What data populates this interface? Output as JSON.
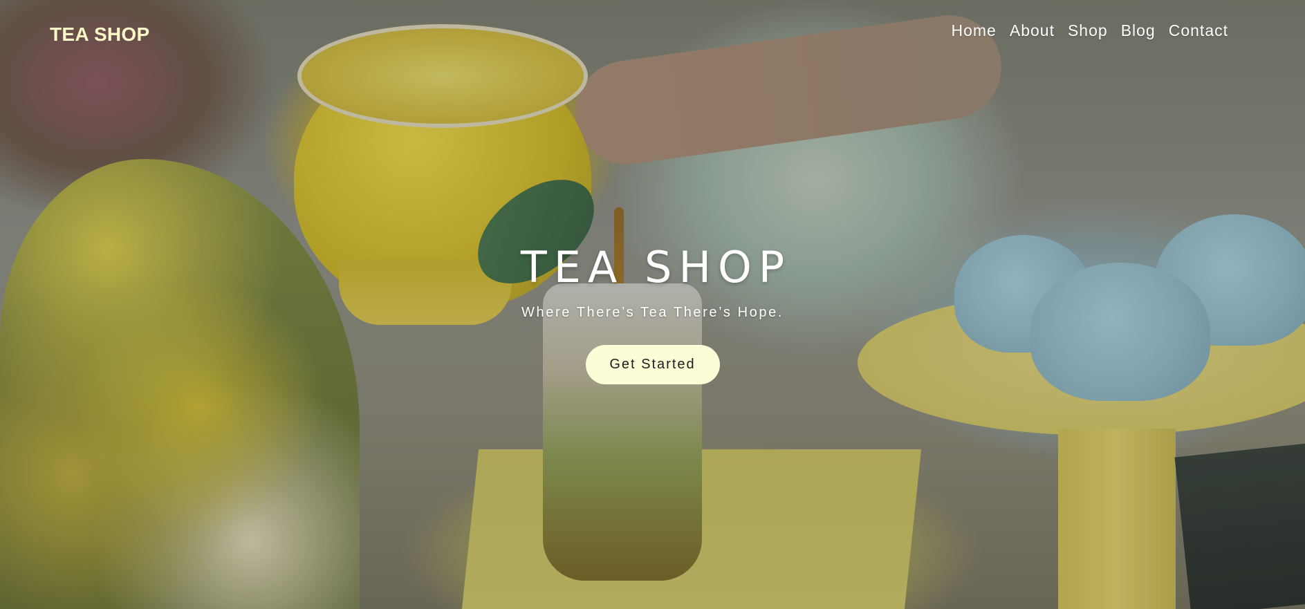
{
  "header": {
    "brand": "TEA SHOP",
    "nav": [
      {
        "label": "Home"
      },
      {
        "label": "About"
      },
      {
        "label": "Shop"
      },
      {
        "label": "Blog"
      },
      {
        "label": "Contact"
      }
    ]
  },
  "hero": {
    "title": "TEA SHOP",
    "tagline": "Where There’s Tea There’s Hope.",
    "cta_label": "Get Started",
    "background_description_icon": "tea-party-photo"
  },
  "colors": {
    "brand_text": "#fbf9c8",
    "nav_text": "#ffffff",
    "cta_background": "#fbfdd6",
    "cta_text": "#1d1d1d"
  }
}
